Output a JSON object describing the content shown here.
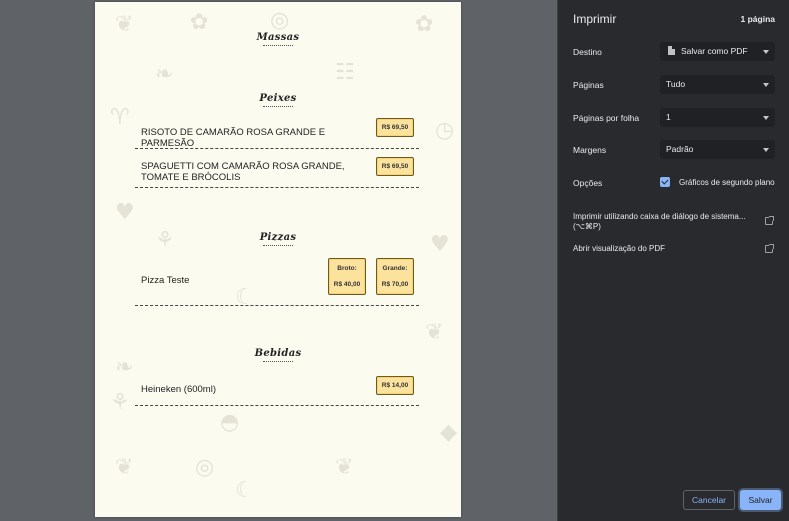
{
  "menu": {
    "sections": [
      {
        "title": "Massas"
      },
      {
        "title": "Peixes"
      },
      {
        "title": "Pizzas"
      },
      {
        "title": "Bebidas"
      }
    ],
    "items": {
      "risoto": {
        "name": "RISOTO DE CAMARÃO ROSA GRANDE E PARMESÃO",
        "price": "R$ 69,50"
      },
      "spaguetti": {
        "name": "SPAGUETTI COM CAMARÃO ROSA GRANDE, TOMATE E BRÓCOLIS",
        "price": "R$ 69,50"
      },
      "pizza": {
        "name": "Pizza Teste",
        "sizes": [
          {
            "label": "Broto:",
            "price": "R$ 40,00"
          },
          {
            "label": "Grande:",
            "price": "R$ 70,00"
          }
        ]
      },
      "heineken": {
        "name": "Heineken (600ml)",
        "price": "R$ 14,00"
      }
    }
  },
  "print": {
    "title": "Imprimir",
    "page_count": "1 página",
    "destination_label": "Destino",
    "destination_value": "Salvar como PDF",
    "pages_label": "Páginas",
    "pages_value": "Tudo",
    "pages_per_sheet_label": "Páginas por folha",
    "pages_per_sheet_value": "1",
    "margins_label": "Margens",
    "margins_value": "Padrão",
    "options_label": "Opções",
    "background_graphics_label": "Gráficos de segundo plano",
    "background_graphics_checked": true,
    "system_dialog_link": "Imprimir utilizando caixa de diálogo de sistema... (⌥⌘P)",
    "open_pdf_link": "Abrir visualização do PDF",
    "cancel_label": "Cancelar",
    "save_label": "Salvar"
  },
  "colors": {
    "sidebar_bg": "#292a2d",
    "accent": "#8ab4f8",
    "paper_bg": "#fcfbf0",
    "price_tag": "#fbe29d"
  }
}
